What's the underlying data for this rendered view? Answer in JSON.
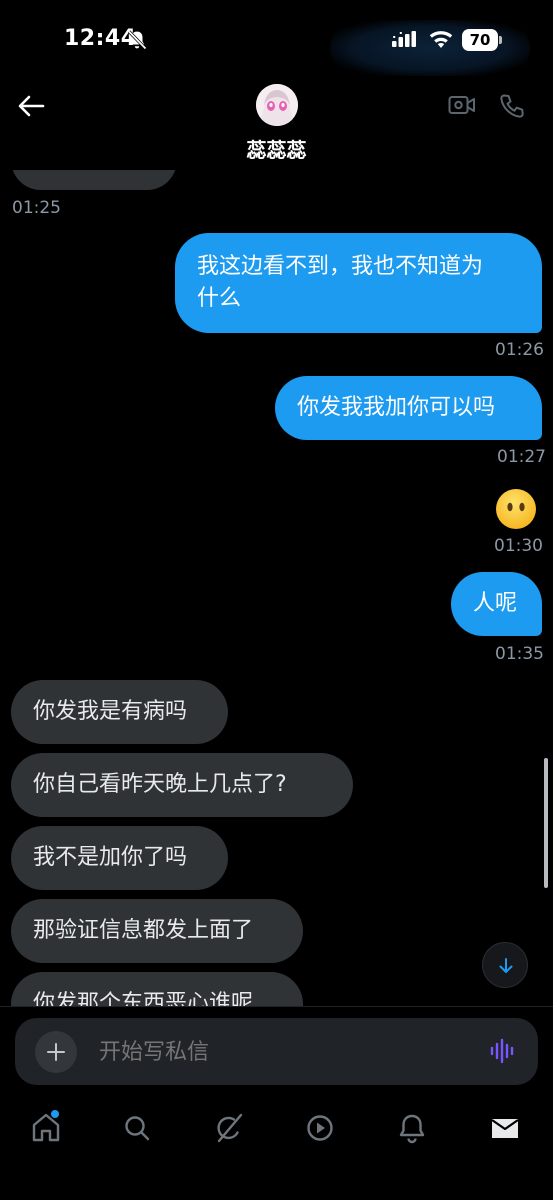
{
  "status_bar": {
    "time": "12:44",
    "battery": "70"
  },
  "header": {
    "contact_name": "蕊蕊蕊"
  },
  "messages": {
    "earlier_time": "01:25",
    "items": [
      {
        "direction": "out",
        "text": "我这边看不到，我也不知道为",
        "text_line2": "什么",
        "time": "01:26"
      },
      {
        "direction": "out",
        "text": "你发我我加你可以吗",
        "time": "01:27"
      },
      {
        "direction": "out",
        "emoji": "face-without-mouth",
        "time": "01:30"
      },
      {
        "direction": "out",
        "text": "人呢",
        "time": "01:35"
      },
      {
        "direction": "in",
        "text": "你发我是有病吗"
      },
      {
        "direction": "in",
        "text": "你自己看昨天晚上几点了?"
      },
      {
        "direction": "in",
        "text": "我不是加你了吗"
      },
      {
        "direction": "in",
        "text": "那验证信息都发上面了"
      },
      {
        "direction": "in",
        "text": "你发那个东西恶心谁呢"
      }
    ]
  },
  "composer": {
    "placeholder": "开始写私信"
  },
  "nav": {
    "items": [
      "home-icon",
      "search-icon",
      "grok-icon",
      "video-icon",
      "bell-icon",
      "mail-icon"
    ]
  },
  "colors": {
    "accent": "#1d9bf0",
    "incoming_bubble": "#2f3336",
    "background": "#000000",
    "voice_accent": "#7856ff"
  }
}
